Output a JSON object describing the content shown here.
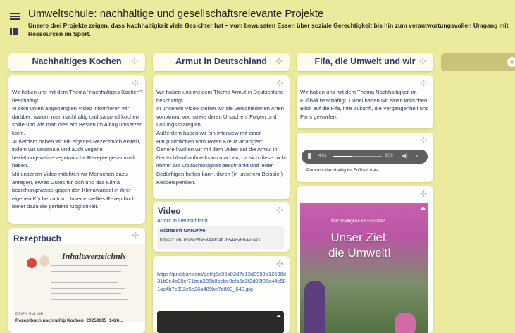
{
  "header": {
    "title": "Umweltschule: nachhaltige und gesellschaftsrelevante Projekte",
    "description": "Unsere drei Projekte zeigen, dass Nachhaltigkeit viele Gesichter hat – vom bewussten Essen über soziale Gerechtigkeit bis hin zum verantwortungsvollen Umgang mit Ressourcen im Sport."
  },
  "columns": [
    {
      "title": "Nachhaltiges Kochen"
    },
    {
      "title": "Armut in Deutschland"
    },
    {
      "title": "Fifa, die Umwelt und wir"
    }
  ],
  "cards": {
    "kochen_text": "Wir haben uns mit dem Thema \"nachhaltiges Kochen\" beschäftigt.\nIn dem unten angehängten Video informieren wir darüber, warum man nachhaltig und saisonal kochen sollte und wie man dies am Besten im Alltag umsetzen kann.\nAußerdem haben wir ein eigenes Rezeptbuch erstellt, indem wir saisonale und auch vegane beziehungsweise vegetarische Rezepte gesammelt haben.\nMit unserem Video möchten wir Menschen dazu anregen, etwas Gutes für sich und das Klima beziehungsweise gegen den Klimawandel in ihrer eigenen Küche zu tun. Unser erstelltes Rezeptbuch bietet dazu die perfekte Möglichkeit.",
    "rezept_title": "Rezeptbuch",
    "rezept_pdf_heading": "Inhaltsverzeichnis",
    "rezept_meta": "PDF • 5.4 MB",
    "rezept_file": "Rezeptbuch nachhaltig Kochen_20250605_1426...",
    "armut_text": "Wir haben uns mit dem Thema Armut in Deutschland beschäftigt.\nIn unserem Video stellen wir die verschiedenen Arten von Armut vor, sowie deren Ursachen, Folgen und Lösungsstrategien.\nAußerdem haben wir ein Interview mit einer Hauptamtlichen vom Roten Kreuz arrangiert.\nGenerell wollen wir mit dem Video auf die Armut in Deutschland aufmerksam machen, da sich diese nicht immer auf Obdachlosigkeit beschränkt und jeder Bedürftigen helfen kann, durch (in unserem Beispiel) Kleiderspenden.",
    "video_title": "Video",
    "video_sub": "Armut in Deutschland",
    "onedrive_title": "Microsoft OneDrive",
    "onedrive_url": "https://1drv.ms/v/c/9a534ed0ab7654e5/EbAx-v43...",
    "pixabay_url": "https://pixabay.com/get/g5a99a02d7e13d8903a12636d31b9e4b90ef71bea336b8bebe0cfa6d2f2d02f06a44c581ac4b7c332c5e26a489be7d800_640.jpg",
    "fifa_text": "Wir haben uns mit dem Thema Nachhaltigkeit im Fußball beschäftigt. Dabei haben wir einen kritischen Blick auf die Fifa, ihre Zukunft, die Vergangenheit und Fans geworfen.",
    "player_time": "4:01",
    "player_total": "9:50",
    "podcast_name": "Podcast Nachhaltig im Fußball.m4a",
    "poster_sign": "Nachhaltigkeit im Fußball?",
    "poster_line1": "Unser Ziel:",
    "poster_line2": "die Umwelt!"
  },
  "icons": {
    "menu": "menu-icon",
    "board": "board-icon",
    "plus": "plus-icon",
    "play": "pause-icon",
    "volume": "volume-icon",
    "forward": "forward-icon",
    "cloud": "cloud-icon"
  }
}
